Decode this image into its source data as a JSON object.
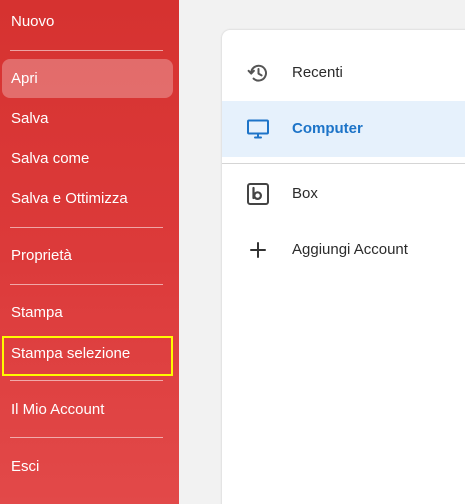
{
  "sidebar": {
    "items": [
      {
        "label": "Nuovo"
      },
      {
        "label": "Apri"
      },
      {
        "label": "Salva"
      },
      {
        "label": "Salva come"
      },
      {
        "label": "Salva e Ottimizza"
      },
      {
        "label": "Proprietà"
      },
      {
        "label": "Stampa"
      },
      {
        "label": "Stampa selezione"
      },
      {
        "label": "Il Mio Account"
      },
      {
        "label": "Esci"
      }
    ],
    "active_item": "Apri",
    "highlighted_item": "Stampa selezione"
  },
  "locations": {
    "items": [
      {
        "label": "Recenti",
        "icon": "history-icon"
      },
      {
        "label": "Computer",
        "icon": "monitor-icon"
      },
      {
        "label": "Box",
        "icon": "box-icon"
      },
      {
        "label": "Aggiungi Account",
        "icon": "plus-icon"
      }
    ],
    "selected_item": "Computer"
  },
  "colors": {
    "sidebar_red": "#dc3a3a",
    "selected_blue": "#1d74c8",
    "selected_background": "#e6f1fc",
    "highlight_yellow": "#fffb00"
  }
}
